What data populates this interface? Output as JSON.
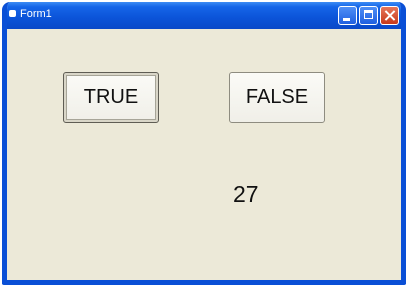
{
  "window": {
    "title": "Form1",
    "controls": [
      "minimize-icon",
      "maximize-icon",
      "close-icon"
    ]
  },
  "buttons": {
    "true_label": "TRUE",
    "false_label": "FALSE"
  },
  "output": {
    "value": "27"
  }
}
